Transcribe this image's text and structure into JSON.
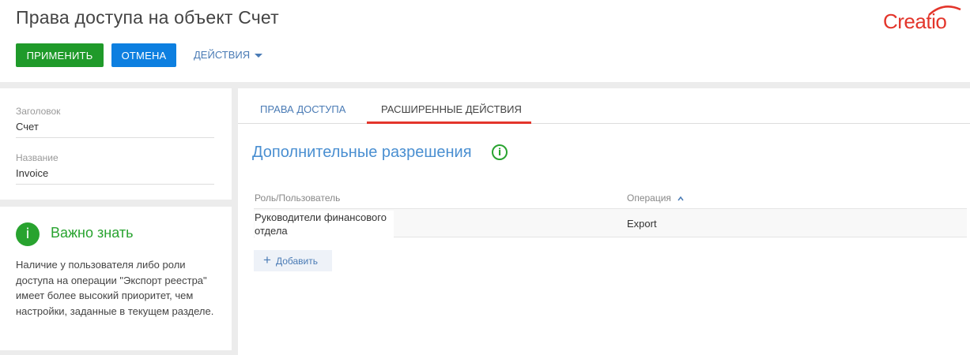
{
  "header": {
    "title": "Права доступа на объект Счет",
    "logo_text": "Creatio",
    "brand_color": "#e3352b"
  },
  "toolbar": {
    "apply_label": "ПРИМЕНИТЬ",
    "cancel_label": "ОТМЕНА",
    "actions_label": "ДЕЙСТВИЯ"
  },
  "record": {
    "fields": [
      {
        "label": "Заголовок",
        "value": "Счет"
      },
      {
        "label": "Название",
        "value": "Invoice"
      }
    ]
  },
  "notice": {
    "title": "Важно знать",
    "icon": "info-icon",
    "text": "Наличие у пользователя либо роли доступа на операции \"Экспорт реестра\" имеет более высокий приоритет, чем настройки, заданные в текущем разделе."
  },
  "tabs": [
    {
      "label": "ПРАВА ДОСТУПА",
      "active": false
    },
    {
      "label": "РАСШИРЕННЫЕ ДЕЙСТВИЯ",
      "active": true
    }
  ],
  "section": {
    "title": "Дополнительные разрешения",
    "info_icon": "info-circle-icon"
  },
  "table": {
    "columns": [
      "Роль/Пользователь",
      "Операция"
    ],
    "sort_column": "Операция",
    "sort_direction": "asc",
    "rows": [
      {
        "role": "Руководители финансового отдела",
        "operation": "Export"
      }
    ]
  },
  "add_label": "Добавить",
  "colors": {
    "apply": "#1f9a2a",
    "cancel": "#0d7fe0",
    "link": "#4a7bb5",
    "success": "#28a32f",
    "accent_tab": "#e3352b"
  }
}
